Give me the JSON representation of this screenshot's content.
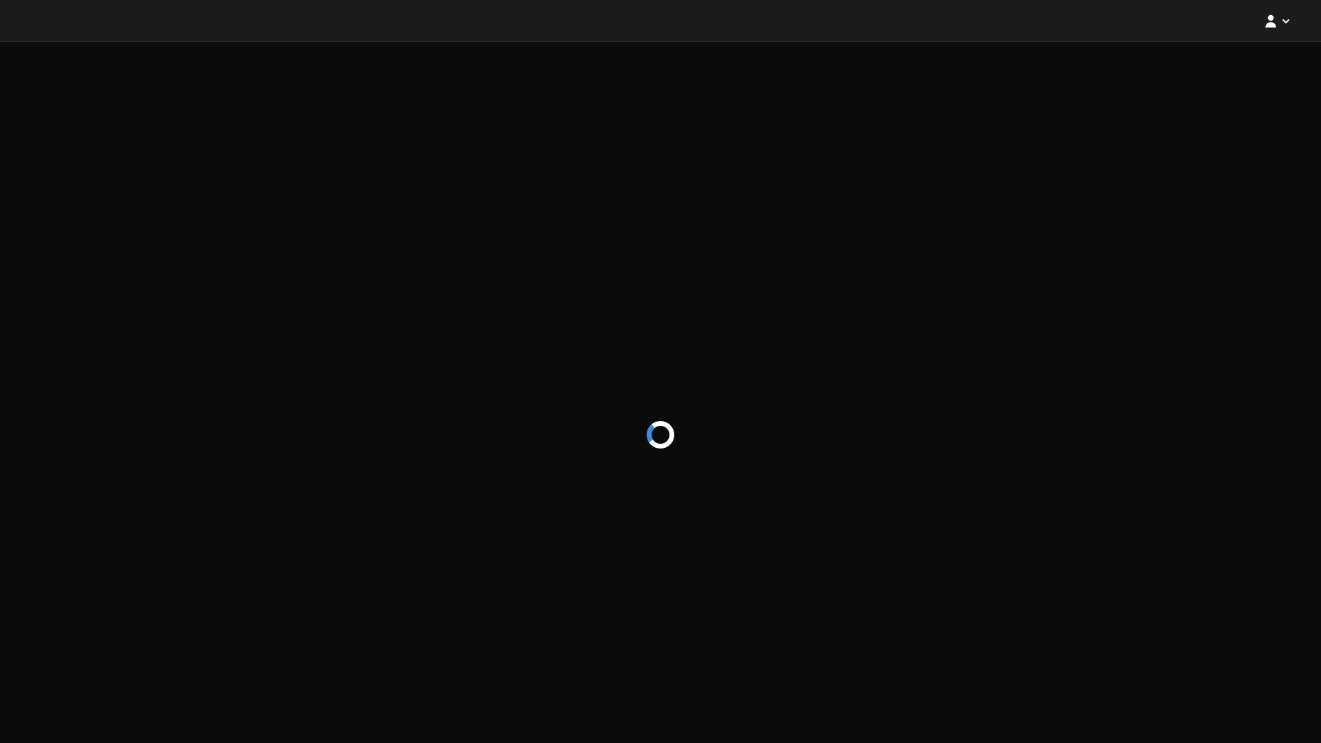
{
  "header": {
    "user_menu": {
      "icon": "user-icon",
      "dropdown_icon": "chevron-down-icon"
    }
  },
  "main": {
    "loading": {
      "icon": "loading-spinner",
      "colors": {
        "ring": "#ffffff",
        "accent": "#3d8bd6"
      }
    }
  },
  "colors": {
    "background": "#0b0b0c",
    "header_background": "#1c1c1d",
    "header_border": "#2a2a2b",
    "icon": "#ffffff"
  }
}
